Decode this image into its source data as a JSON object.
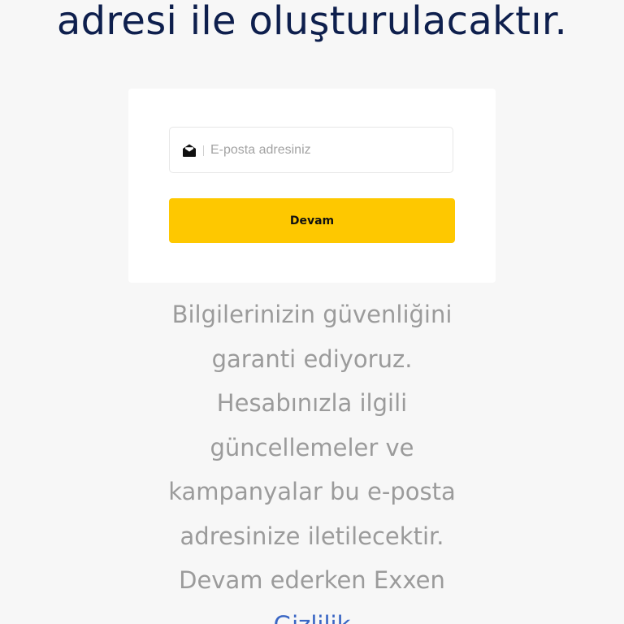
{
  "heading": {
    "text": "adresi ile oluşturulacaktır."
  },
  "form": {
    "email_placeholder": "E-posta adresiniz",
    "email_icon": "envelope-icon",
    "continue_label": "Devam"
  },
  "info": {
    "text": "Bilgilerinizin güvenliğini garanti ediyoruz. Hesabınızla ilgili güncellemeler ve kampanyalar bu e-posta adresinize iletilecektir. Devam ederken Exxen ",
    "privacy_link": "Gizlilik"
  },
  "colors": {
    "background": "#f7f7f7",
    "heading": "#0e1f4d",
    "button": "#fec800",
    "info_text": "#9b9b9b",
    "link": "#3a66c4"
  }
}
